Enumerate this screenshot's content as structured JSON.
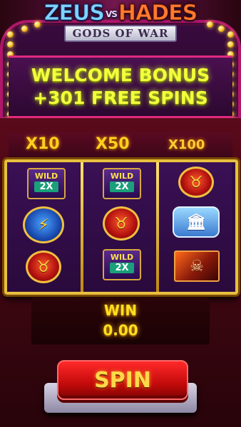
{
  "logo": {
    "zeus": "ZEUS",
    "vs": "VS",
    "hades": "HADES",
    "subtitle": "GODS OF WAR"
  },
  "banner": {
    "line1": "WELCOME BONUS",
    "line2": "+301 FREE SPINS"
  },
  "multipliers": [
    "X10",
    "X50",
    "X100"
  ],
  "reels": [
    [
      {
        "type": "wild",
        "label": "WILD",
        "mult": "2X"
      },
      {
        "type": "bolt",
        "icon": "lightning-icon"
      },
      {
        "type": "bull",
        "icon": "bull-icon"
      }
    ],
    [
      {
        "type": "wild",
        "label": "WILD",
        "mult": "2X"
      },
      {
        "type": "bull",
        "icon": "bull-icon"
      },
      {
        "type": "wild",
        "label": "WILD",
        "mult": "2X"
      }
    ],
    [
      {
        "type": "bull",
        "icon": "bull-icon"
      },
      {
        "type": "temple",
        "icon": "temple-icon"
      },
      {
        "type": "monster",
        "icon": "hades-monster-icon"
      }
    ]
  ],
  "win": {
    "label": "WIN",
    "value": "0.00"
  },
  "spin": {
    "label": "SPIN"
  },
  "colors": {
    "accent_yellow": "#f4ff3a",
    "frame_gold": "#e8c040",
    "spin_red": "#d01010",
    "wild_green": "#1aa07a"
  }
}
